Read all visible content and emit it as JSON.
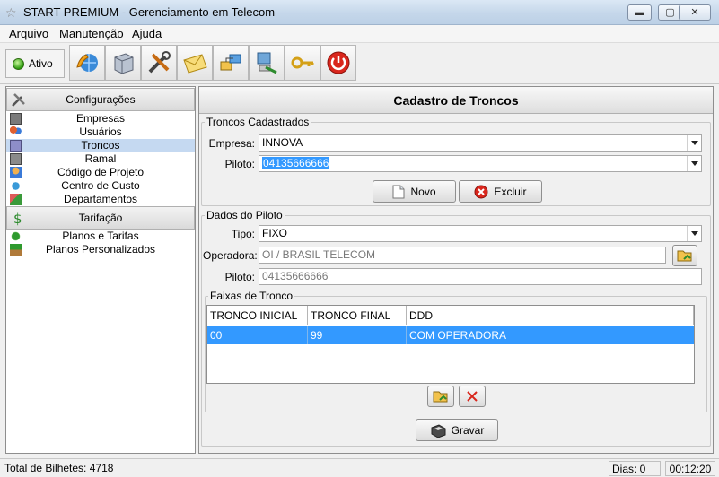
{
  "window": {
    "title": "START PREMIUM - Gerenciamento em Telecom",
    "controls": {
      "minimize": "▭",
      "maximize": "▢",
      "close": "✕"
    }
  },
  "menu": {
    "items": [
      "Arquivo",
      "Manutenção",
      "Ajuda"
    ]
  },
  "toolbar": {
    "status_label": "Ativo",
    "buttons": [
      "phone-globe-icon",
      "server-icon",
      "tools-icon",
      "mail-icon",
      "network-icon",
      "computer-config-icon",
      "key-icon",
      "power-icon"
    ]
  },
  "sidebar": {
    "sections": [
      {
        "label": "Configurações",
        "icon": "tools-icon",
        "items": [
          {
            "label": "Empresas",
            "icon": "building-icon"
          },
          {
            "label": "Usuários",
            "icon": "users-icon"
          },
          {
            "label": "Troncos",
            "icon": "trunk-icon",
            "selected": true
          },
          {
            "label": "Ramal",
            "icon": "phone-icon"
          },
          {
            "label": "Código de Projeto",
            "icon": "project-icon"
          },
          {
            "label": "Centro de Custo",
            "icon": "cost-center-icon"
          },
          {
            "label": "Departamentos",
            "icon": "department-icon"
          }
        ]
      },
      {
        "label": "Tarifação",
        "icon": "money-icon",
        "items": [
          {
            "label": "Planos e Tarifas",
            "icon": "plans-icon"
          },
          {
            "label": "Planos Personalizados",
            "icon": "custom-plans-icon"
          }
        ]
      }
    ]
  },
  "main": {
    "title": "Cadastro de Troncos",
    "troncos_cadastrados": {
      "legend": "Troncos Cadastrados",
      "empresa_label": "Empresa:",
      "empresa_value": "INNOVA",
      "piloto_label": "Piloto:",
      "piloto_value": "04135666666",
      "novo_label": "Novo",
      "excluir_label": "Excluir"
    },
    "dados_piloto": {
      "legend": "Dados do Piloto",
      "tipo_label": "Tipo:",
      "tipo_value": "FIXO",
      "operadora_label": "Operadora:",
      "operadora_value": "OI / BRASIL TELECOM",
      "piloto_label": "Piloto:",
      "piloto_value": "04135666666"
    },
    "faixas": {
      "legend": "Faixas de Tronco",
      "columns": [
        "TRONCO INICIAL",
        "TRONCO FINAL",
        "DDD"
      ],
      "rows": [
        [
          "00",
          "99",
          "COM OPERADORA"
        ]
      ]
    },
    "gravar_label": "Gravar"
  },
  "statusbar": {
    "total": "Total de Bilhetes: 4718",
    "dias": "Dias: 0",
    "time": "00:12:20"
  },
  "colors": {
    "selection": "#3399ff",
    "tree_selected": "#c5d9f1",
    "titlebar": "#c5d7ea"
  }
}
